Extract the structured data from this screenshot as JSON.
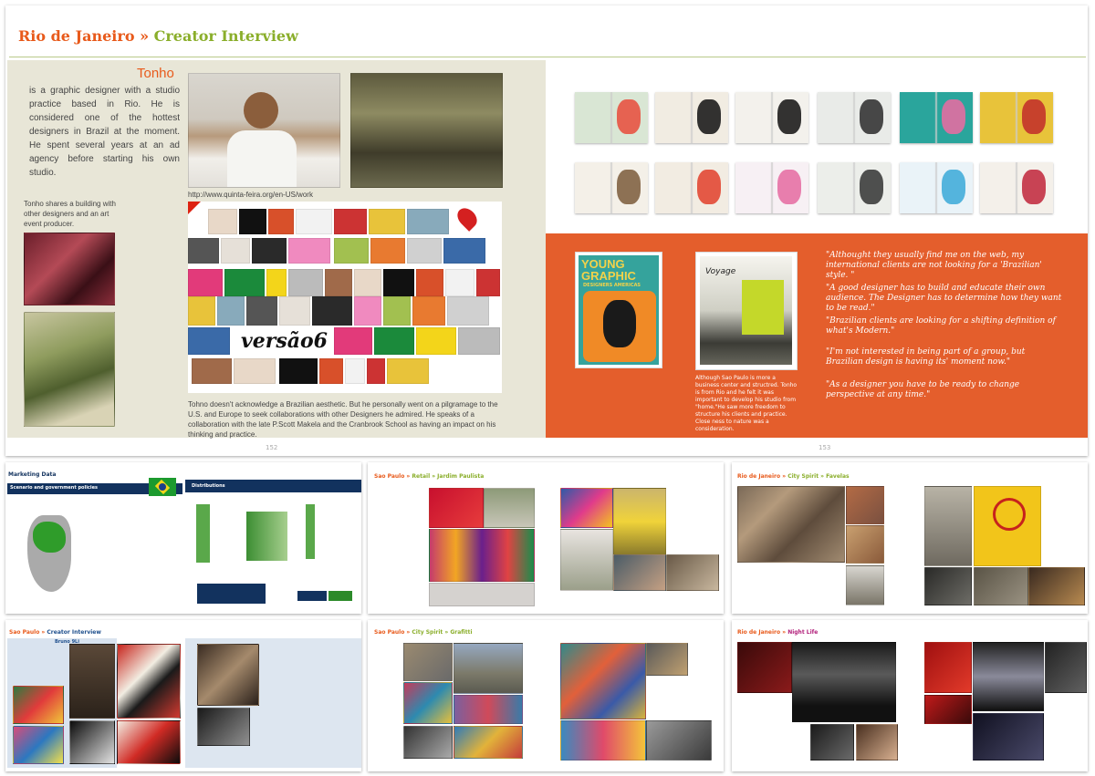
{
  "main": {
    "city": "Rio de Janeiro",
    "separator": "»",
    "section": "Creator Interview",
    "name": "Tonho",
    "bio": "is a graphic designer with a studio practice based in Rio. He is considered one of the hottest designers in Brazil at the moment. He spent several years at an ad agency before starting his own studio.",
    "building_caption": "Tonho shares a building with other designers and an art event producer.",
    "url": "http://www.quinta-feira.org/en-US/work",
    "pilgrimage": "Tohno doesn't acknowledge a Brazilian aesthetic. But he personally went on a pilgramage to the U.S. and Europe to seek collaborations with other Designers he admired. He speaks of a collaboration with the late P.Scott Makela and the Cranbrook School as having an impact on his thinking and practice.",
    "versao_label": "versão6",
    "book1": {
      "line1": "YOUNG",
      "line2": "GRAPHIC",
      "line3": "DESIGNERS AMERICAS"
    },
    "book2_label": "Voyage",
    "book_caption": "Although Sao Paulo is more a business center and structred. Tonho is from Rio and he felt it was important to develop his studio from \"home.\"He saw more freedom to structure his clients and practice. Close ness to nature was a consideration.",
    "quotes": [
      "\"Althought they usually find me on the web, my international clients are not looking for a 'Brazilian' style. \"",
      "\"A good designer has to build and educate their own audience. The Designer has to determine how they want to be read.\"",
      "\"Brazilian clients are looking for a shifting definition of what's Modern.\"",
      "\"I'm not interested in being part of a group, but Brazilian design is having its' moment now.\"",
      "\"As a designer you have to be ready to change perspective at any time.\""
    ],
    "page_left": "152",
    "page_right": "153"
  },
  "thumbs": {
    "marketing": {
      "title": "Marketing Data",
      "subtitle": "Scenario and government policies",
      "distributions": "Distributions"
    },
    "sp_retail": {
      "city": "Sao Paulo",
      "sep": "»",
      "section": "Retail » Jardim Paulista"
    },
    "rio_favelas": {
      "city": "Rio de Janeiro",
      "sep": "»",
      "section": "City Spirit » Favelas"
    },
    "sp_creator": {
      "city": "Sao Paulo",
      "sep": "»",
      "section": "Creator Interview",
      "name": "Bruno 9Li"
    },
    "sp_graffiti": {
      "city": "Sao Paulo",
      "sep": "»",
      "section": "City Spirit » Grafitti"
    },
    "rio_night": {
      "city": "Rio de Janeiro",
      "sep": "»",
      "section": "Night Life"
    }
  },
  "colors": {
    "orange": "#e45e2c",
    "title_orange": "#e85a1b",
    "title_green": "#8aae2a",
    "panel": "#e8e6d7",
    "navy": "#12325e"
  }
}
